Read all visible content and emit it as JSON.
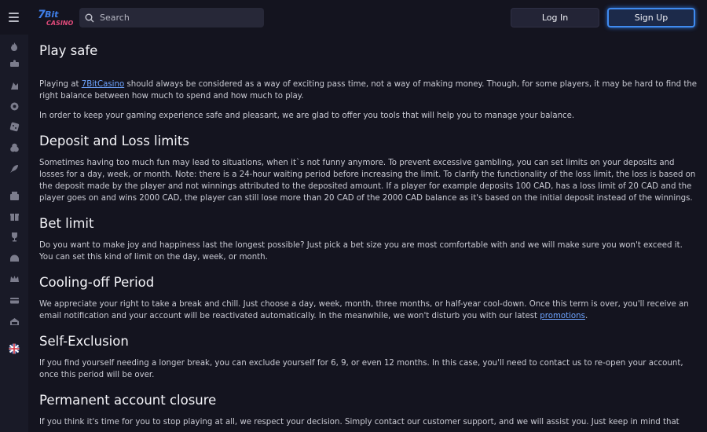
{
  "header": {
    "search_placeholder": "Search",
    "login_label": "Log In",
    "signup_label": "Sign Up",
    "logo_text": "7Bit CASINO"
  },
  "content": {
    "title": "Play safe",
    "intro_p1_prefix": "Playing at ",
    "intro_p1_link": "7BitCasino",
    "intro_p1_suffix": " should always be considered as a way of exciting pass time, not a way of making money. Though, for some players, it may be hard to find the right balance between how much to spend and how much to play.",
    "intro_p2": "In order to keep your gaming experience safe and pleasant, we are glad to offer you tools that will help you to manage your balance.",
    "sections": [
      {
        "heading": "Deposit and Loss limits",
        "text": "Sometimes having too much fun may lead to situations, when it`s not funny anymore. To prevent excessive gambling, you can set limits on your deposits and losses for a day, week, or month. Note: there is a 24-hour waiting period before increasing the limit. To clarify the functionality of the loss limit, the loss is based on the deposit made by the player and not winnings attributed to the deposited amount. If a player for example deposits 100 CAD, has a loss limit of 20 CAD and the player goes on and wins 2000 CAD, the player can still lose more than 20 CAD of the 2000 CAD balance as it's based on the initial deposit instead of the winnings."
      },
      {
        "heading": "Bet limit",
        "text": "Do you want to make joy and happiness last the longest possible? Just pick a bet size you are most comfortable with and we will make sure you won't exceed it. You can set this kind of limit on the day, week, or month."
      },
      {
        "heading": "Cooling-off Period",
        "text_prefix": "We appreciate your right to take a break and chill. Just choose a day, week, month, three months, or half-year cool-down. Once this term is over, you'll receive an email notification and your account will be reactivated automatically. In the meanwhile, we won't disturb you with our latest ",
        "text_link": "promotions",
        "text_suffix": "."
      },
      {
        "heading": "Self-Exclusion",
        "text": "If you find yourself needing a longer break, you can exclude yourself for 6, 9, or even 12 months. In this case, you'll need to contact us to re-open your account, once this period will be over."
      },
      {
        "heading": "Permanent account closure",
        "text": "If you think it's time for you to stop playing at all, we respect your decision. Simply contact our customer support, and we will assist you. Just keep in mind that"
      }
    ]
  },
  "sidebar": {
    "icons": [
      "fire-icon",
      "slots-icon",
      "table-games-icon",
      "roulette-icon",
      "dice-icon",
      "cards-icon",
      "rocket-icon",
      "live-casino-icon",
      "gift-icon",
      "trophy-icon",
      "vip-icon",
      "crown-icon",
      "payments-icon",
      "support-icon",
      "uk-flag-icon"
    ]
  },
  "colors": {
    "background": "#14141f",
    "sidebar": "#191a27",
    "link": "#6ea4ff",
    "signup_border": "#3f8bf0"
  }
}
